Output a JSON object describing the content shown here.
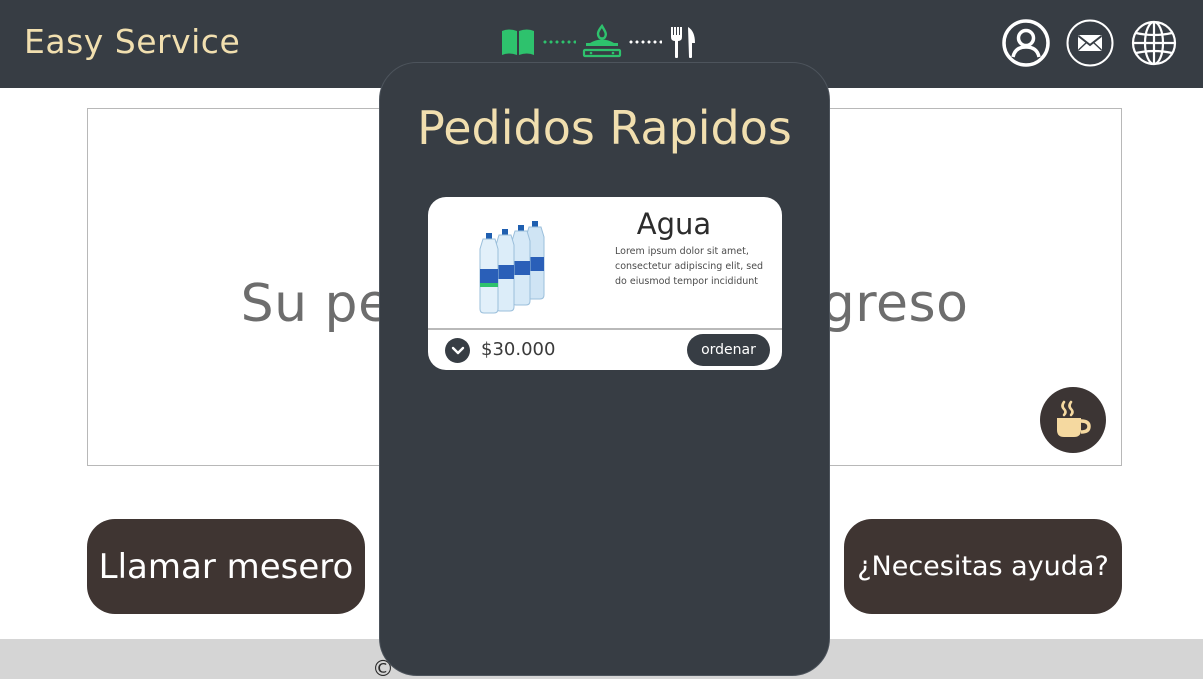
{
  "app": {
    "brand": "Easy Service"
  },
  "progress": {
    "steps": [
      {
        "icon": "open-book-icon",
        "state": "done"
      },
      {
        "icon": "cooking-pot-icon",
        "state": "active"
      },
      {
        "icon": "fork-knife-icon",
        "state": "pending"
      }
    ]
  },
  "header": {
    "icons": [
      "user-profile-icon",
      "mail-icon",
      "globe-icon"
    ]
  },
  "status": {
    "text": "Su pedido está en progreso"
  },
  "actions": {
    "call_waiter": "Llamar mesero",
    "help": "¿Necesitas ayuda?"
  },
  "footer": {
    "copyright_symbol": "©"
  },
  "modal": {
    "title": "Pedidos Rapidos",
    "product": {
      "name": "Agua",
      "description": "Lorem ipsum dolor sit amet, consectetur adipiscing elit, sed do eiusmod tempor incididunt",
      "price": "$30.000",
      "order_label": "ordenar",
      "image": "water-bottles-image"
    }
  },
  "colors": {
    "header_bg": "#373d44",
    "brand": "#f1dfaf",
    "progress_active": "#2ec26d",
    "action_button_bg": "#3f3532",
    "coffee_icon": "#f5d9a0"
  }
}
